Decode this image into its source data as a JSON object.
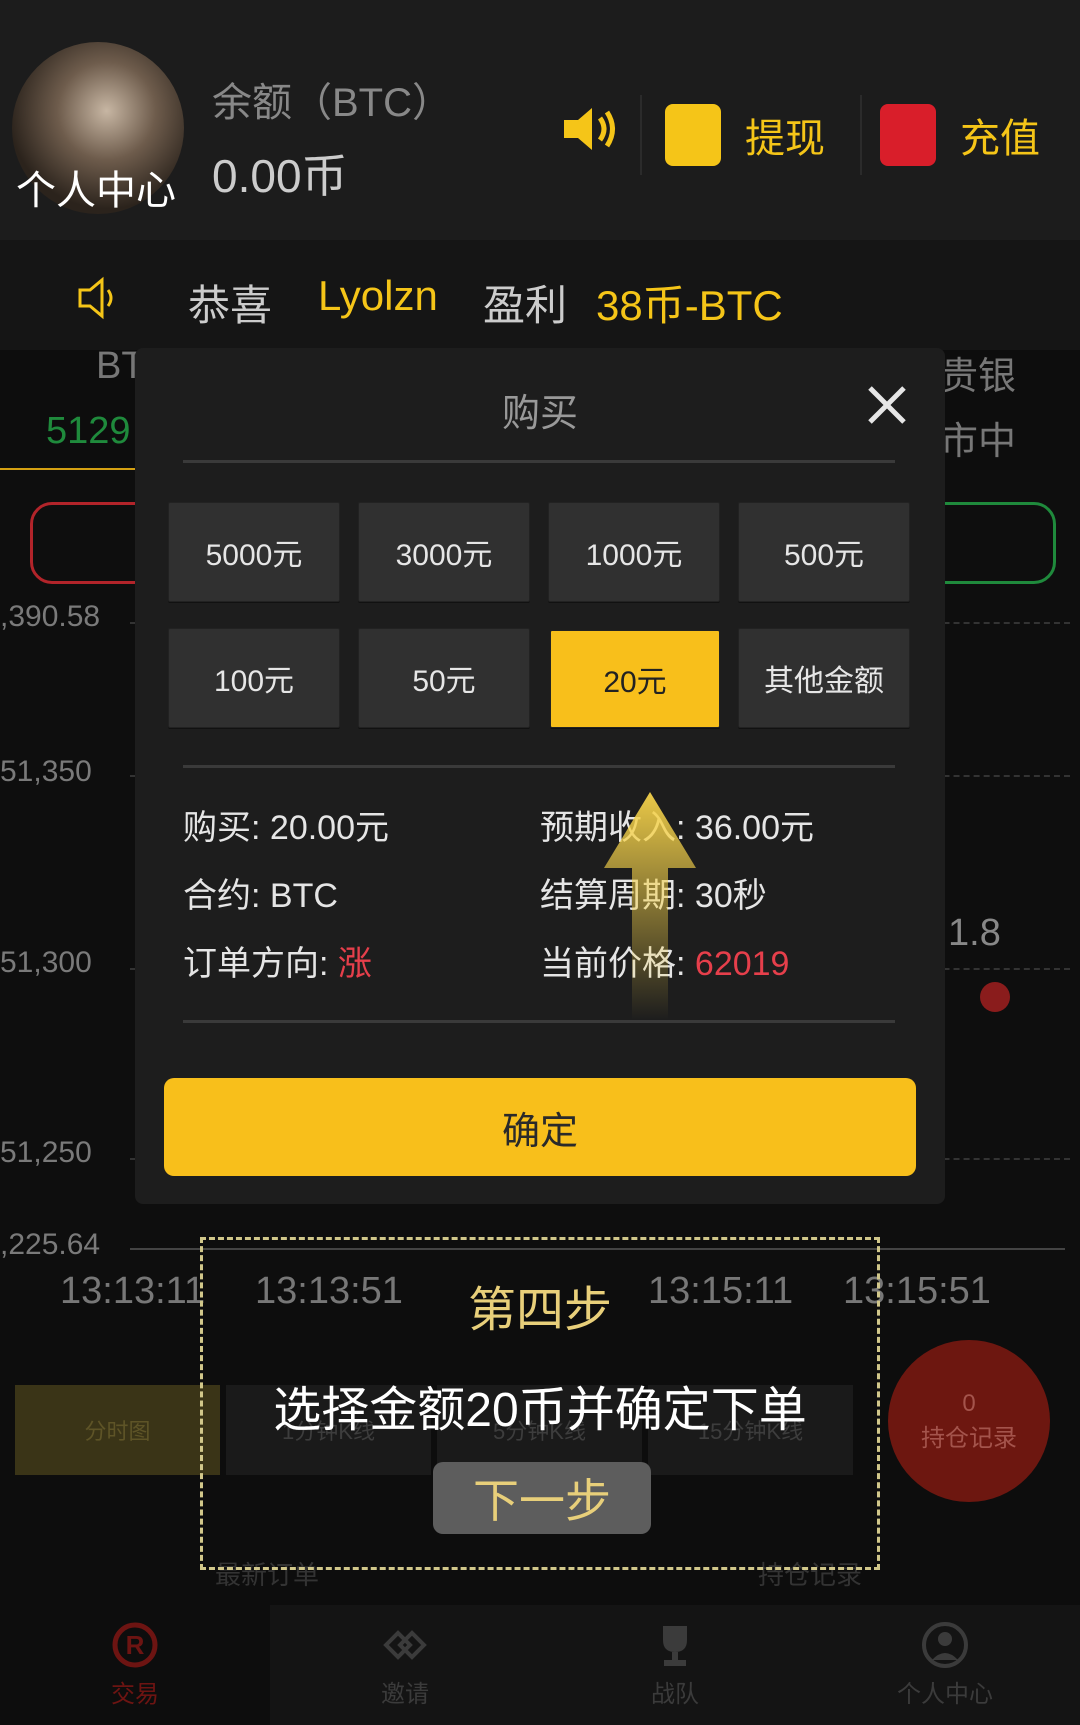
{
  "header": {
    "avatar_label": "个人中心",
    "balance_label": "余额（BTC）",
    "balance_value": "0.00币",
    "withdraw_label": "提现",
    "recharge_label": "充值"
  },
  "marquee": {
    "prefix": "恭喜",
    "user": "Lyolzn",
    "middle": "盈利",
    "amount": "38币-BTC"
  },
  "market": {
    "tab_left": "BT",
    "price_left": "5129",
    "tab_right": "贵银",
    "tab_right_sub": "市中",
    "y_labels": [
      ",390.58",
      "51,350",
      "51,300",
      "51,250",
      ",225.64"
    ],
    "x_labels": [
      "13:13:11",
      "13:13:51",
      "13:15:11",
      "13:15:51"
    ],
    "right_value": "1.8",
    "kline_tabs": [
      "分时图",
      "1分钟K线",
      "5分钟K线",
      "15分钟K线"
    ],
    "hold_count": "0",
    "hold_label": "持仓记录",
    "list_left": "最新订单",
    "list_right": "持仓记录"
  },
  "nav": {
    "items": [
      {
        "label": "交易",
        "icon": "trade-icon"
      },
      {
        "label": "邀请",
        "icon": "invite-icon"
      },
      {
        "label": "战队",
        "icon": "trophy-icon"
      },
      {
        "label": "个人中心",
        "icon": "user-icon"
      }
    ]
  },
  "modal": {
    "title": "购买",
    "amounts": [
      "5000元",
      "3000元",
      "1000元",
      "500元",
      "100元",
      "50元",
      "20元",
      "其他金额"
    ],
    "selected_amount": "20元",
    "buy_label": "购买: ",
    "buy_value": "20.00元",
    "expected_label": "预期收入: ",
    "expected_value": "36.00元",
    "contract_label": "合约: ",
    "contract_value": "BTC",
    "period_label": "结算周期: ",
    "period_value": "30秒",
    "direction_label": "订单方向: ",
    "direction_value": "涨",
    "price_label": "当前价格: ",
    "price_value": "62019",
    "confirm_label": "确定"
  },
  "guide": {
    "step": "第四步",
    "text": "选择金额20币并确定下单",
    "next_label": "下一步"
  },
  "colors": {
    "accent": "#f8bf1b",
    "red": "#e63f4b",
    "modal_bg": "#1d1d1d"
  }
}
